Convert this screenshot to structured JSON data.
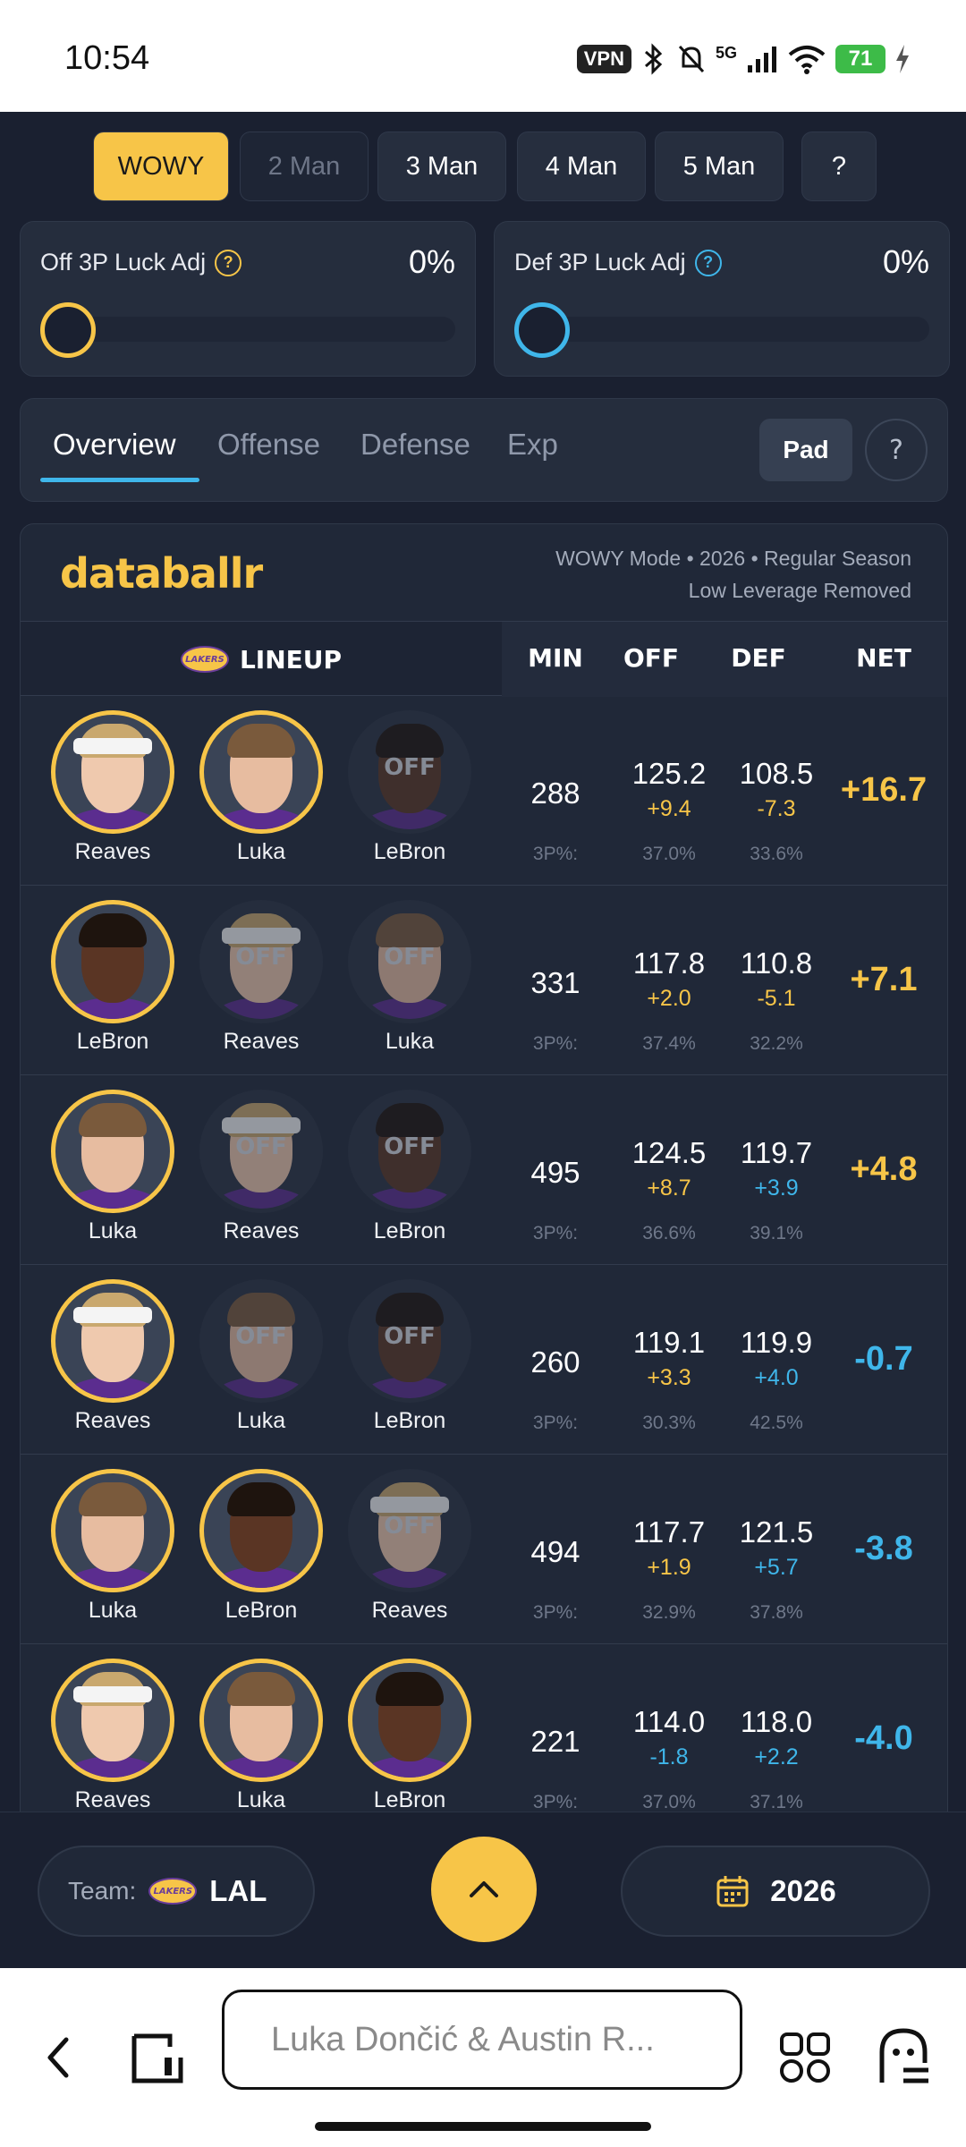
{
  "status_bar": {
    "time": "10:54",
    "vpn": "VPN",
    "network": "5G",
    "battery": "71"
  },
  "mode_buttons": [
    {
      "label": "WOWY",
      "state": "active"
    },
    {
      "label": "2 Man",
      "state": "disabled"
    },
    {
      "label": "3 Man",
      "state": "normal"
    },
    {
      "label": "4 Man",
      "state": "normal"
    },
    {
      "label": "5 Man",
      "state": "normal"
    },
    {
      "label": "?",
      "state": "normal"
    }
  ],
  "sliders": {
    "off": {
      "label": "Off 3P Luck Adj",
      "value": "0%",
      "color": "#f7c548"
    },
    "def": {
      "label": "Def 3P Luck Adj",
      "value": "0%",
      "color": "#3fb6ea"
    }
  },
  "tabs": [
    {
      "label": "Overview",
      "active": true
    },
    {
      "label": "Offense",
      "active": false
    },
    {
      "label": "Defense",
      "active": false
    },
    {
      "label": "Exp",
      "active": false
    }
  ],
  "pad_button": "Pad",
  "help_button": "?",
  "brand": "databallr",
  "meta": {
    "line1": "WOWY Mode • 2026 • Regular Season",
    "line2": "Low Leverage Removed"
  },
  "table": {
    "headers": {
      "lineup": "LINEUP",
      "min": "MIN",
      "off": "OFF",
      "def": "DEF",
      "net": "NET"
    },
    "team_logo_text": "LAKERS",
    "off_tag": "OFF",
    "three_pt_label": "3P%:",
    "rows": [
      {
        "players": [
          {
            "name": "Reaves",
            "on": true
          },
          {
            "name": "Luka",
            "on": true
          },
          {
            "name": "LeBron",
            "on": false
          }
        ],
        "min": "288",
        "off": "125.2",
        "off_delta": "+9.4",
        "off_3p": "37.0%",
        "def": "108.5",
        "def_delta": "-7.3",
        "def_3p": "33.6%",
        "net": "+16.7",
        "off_good": true,
        "def_good": true,
        "net_good": true
      },
      {
        "players": [
          {
            "name": "LeBron",
            "on": true
          },
          {
            "name": "Reaves",
            "on": false
          },
          {
            "name": "Luka",
            "on": false
          }
        ],
        "min": "331",
        "off": "117.8",
        "off_delta": "+2.0",
        "off_3p": "37.4%",
        "def": "110.8",
        "def_delta": "-5.1",
        "def_3p": "32.2%",
        "net": "+7.1",
        "off_good": true,
        "def_good": true,
        "net_good": true
      },
      {
        "players": [
          {
            "name": "Luka",
            "on": true
          },
          {
            "name": "Reaves",
            "on": false
          },
          {
            "name": "LeBron",
            "on": false
          }
        ],
        "min": "495",
        "off": "124.5",
        "off_delta": "+8.7",
        "off_3p": "36.6%",
        "def": "119.7",
        "def_delta": "+3.9",
        "def_3p": "39.1%",
        "net": "+4.8",
        "off_good": true,
        "def_good": false,
        "net_good": true
      },
      {
        "players": [
          {
            "name": "Reaves",
            "on": true
          },
          {
            "name": "Luka",
            "on": false
          },
          {
            "name": "LeBron",
            "on": false
          }
        ],
        "min": "260",
        "off": "119.1",
        "off_delta": "+3.3",
        "off_3p": "30.3%",
        "def": "119.9",
        "def_delta": "+4.0",
        "def_3p": "42.5%",
        "net": "-0.7",
        "off_good": true,
        "def_good": false,
        "net_good": false
      },
      {
        "players": [
          {
            "name": "Luka",
            "on": true
          },
          {
            "name": "LeBron",
            "on": true
          },
          {
            "name": "Reaves",
            "on": false
          }
        ],
        "min": "494",
        "off": "117.7",
        "off_delta": "+1.9",
        "off_3p": "32.9%",
        "def": "121.5",
        "def_delta": "+5.7",
        "def_3p": "37.8%",
        "net": "-3.8",
        "off_good": true,
        "def_good": false,
        "net_good": false
      },
      {
        "players": [
          {
            "name": "Reaves",
            "on": true
          },
          {
            "name": "Luka",
            "on": true
          },
          {
            "name": "LeBron",
            "on": true
          }
        ],
        "min": "221",
        "off": "114.0",
        "off_delta": "-1.8",
        "off_3p": "37.0%",
        "def": "118.0",
        "def_delta": "+2.2",
        "def_3p": "37.1%",
        "net": "-4.0",
        "off_good": false,
        "def_good": false,
        "net_good": false
      }
    ]
  },
  "bottom_bar": {
    "team_label": "Team:",
    "team_value": "LAL",
    "year": "2026"
  },
  "browser": {
    "url_text": "Luka Dončić & Austin R..."
  },
  "colors": {
    "accent": "#f7c548",
    "blue": "#3fb6ea",
    "background": "#1a2030"
  }
}
